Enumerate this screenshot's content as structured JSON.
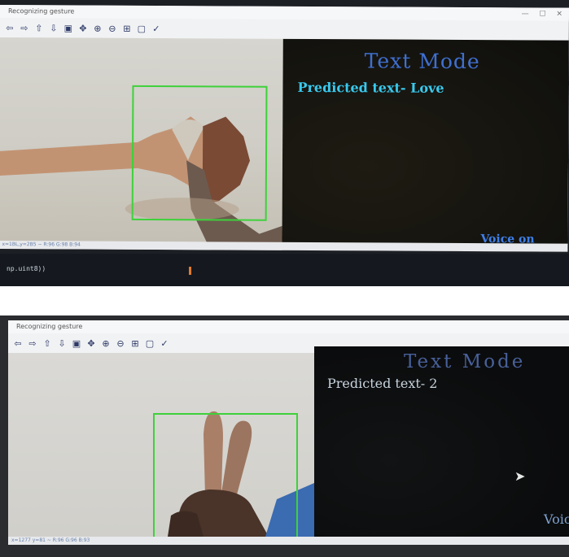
{
  "screenshots": [
    {
      "window_title": "Recognizing gesture",
      "status_text": "x=1BL,y=2B5 ~ R:96 G:98 B:94",
      "mode_title": "Text Mode",
      "predicted_text": "Predicted text- Love",
      "voice_status": "Voice on",
      "terminal_snippet": "np.uint8))"
    },
    {
      "window_title": "Recognizing gesture",
      "status_text": "x=1277 y=81 ~ R:96 G:96 B:93",
      "mode_title": "Text Mode",
      "predicted_text": "Predicted text- 2",
      "voice_status": "Voic"
    }
  ],
  "toolbar_icons": [
    "arrow-left-icon",
    "arrow-right-icon",
    "arrow-up-icon",
    "arrow-down-icon",
    "save-icon",
    "pan-icon",
    "zoom-in-icon",
    "zoom-out-icon",
    "fit-icon",
    "select-icon",
    "settings-icon"
  ],
  "toolbar_glyphs": [
    "⇦",
    "⇨",
    "⇧",
    "⇩",
    "▣",
    "✥",
    "⊕",
    "⊖",
    "⊞",
    "▢",
    "✓"
  ],
  "colors": {
    "roi_box": "#3ed13a",
    "mode_title": "#3f6fd0",
    "predicted_text": "#39c9ee",
    "voice_status": "#3f7fe8"
  }
}
